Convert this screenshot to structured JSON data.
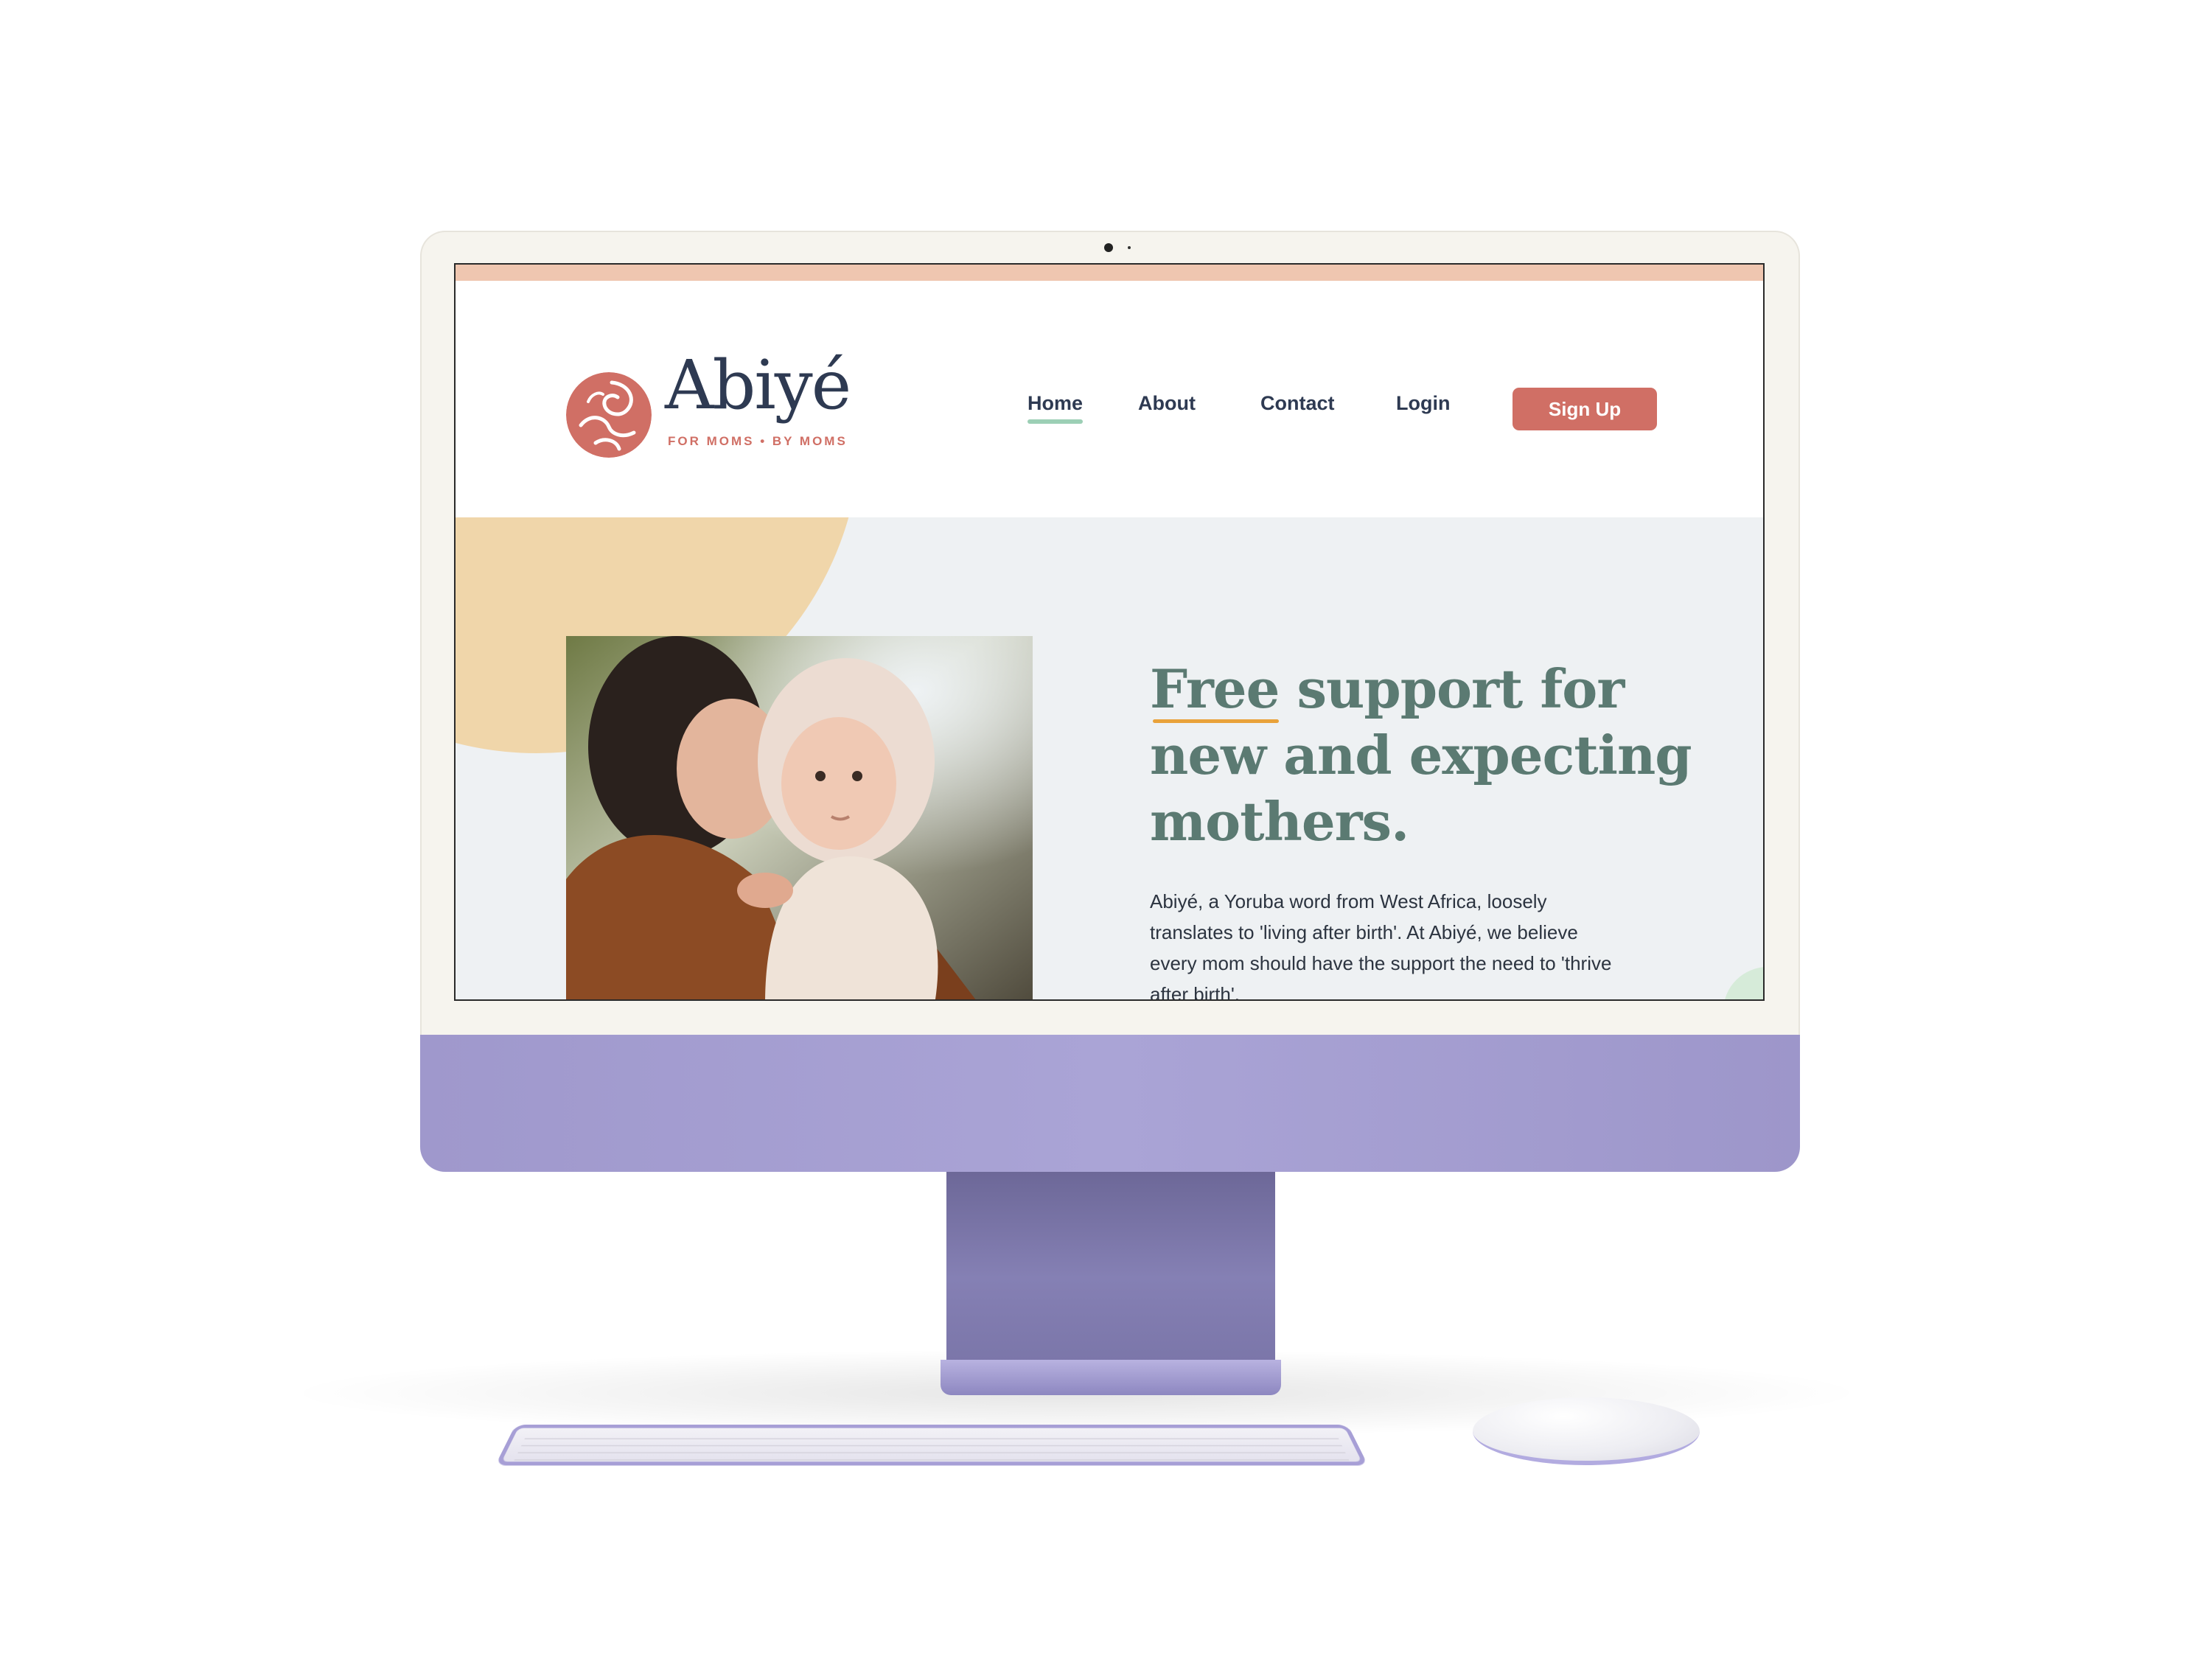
{
  "brand": {
    "name": "Abiyé",
    "tagline": "FOR MOMS • BY MOMS"
  },
  "nav": {
    "items": [
      {
        "label": "Home",
        "active": true
      },
      {
        "label": "About",
        "active": false
      },
      {
        "label": "Contact",
        "active": false
      },
      {
        "label": "Login",
        "active": false
      }
    ],
    "cta_label": "Sign Up"
  },
  "hero": {
    "headline_lines": [
      "Free support for",
      "new and expecting",
      "mothers."
    ],
    "headline_underlined_word": "Free",
    "body": "Abiyé, a Yoruba word from West Africa, loosely translates to 'living after birth'. At Abiyé, we believe every mom should have the support the need to 'thrive after birth'.",
    "photo_icon": "mother-kissing-baby-photo"
  },
  "colors": {
    "top_strip": "#efc6b0",
    "brand_coral": "#d06f65",
    "navy": "#2e3a52",
    "nav_underline": "#9ccfb5",
    "hero_bg": "#eef1f3",
    "blob_sand": "#f0d6aa",
    "headline": "#5b7a72",
    "underline_accent": "#e9a23a",
    "body_text": "#2c3440",
    "device_purple": "#a59ed3"
  }
}
